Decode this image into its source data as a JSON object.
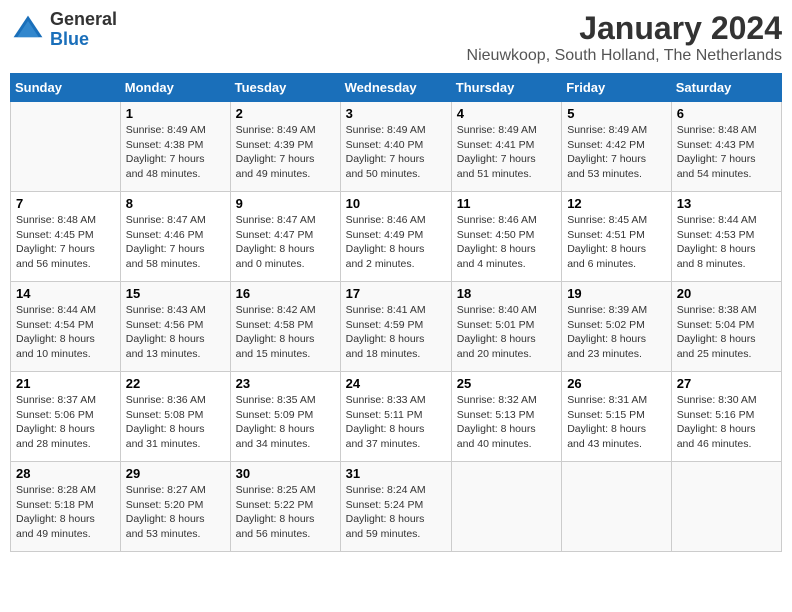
{
  "header": {
    "logo_line1": "General",
    "logo_line2": "Blue",
    "title": "January 2024",
    "subtitle": "Nieuwkoop, South Holland, The Netherlands"
  },
  "calendar": {
    "days_of_week": [
      "Sunday",
      "Monday",
      "Tuesday",
      "Wednesday",
      "Thursday",
      "Friday",
      "Saturday"
    ],
    "weeks": [
      [
        {
          "day": "",
          "info": ""
        },
        {
          "day": "1",
          "info": "Sunrise: 8:49 AM\nSunset: 4:38 PM\nDaylight: 7 hours\nand 48 minutes."
        },
        {
          "day": "2",
          "info": "Sunrise: 8:49 AM\nSunset: 4:39 PM\nDaylight: 7 hours\nand 49 minutes."
        },
        {
          "day": "3",
          "info": "Sunrise: 8:49 AM\nSunset: 4:40 PM\nDaylight: 7 hours\nand 50 minutes."
        },
        {
          "day": "4",
          "info": "Sunrise: 8:49 AM\nSunset: 4:41 PM\nDaylight: 7 hours\nand 51 minutes."
        },
        {
          "day": "5",
          "info": "Sunrise: 8:49 AM\nSunset: 4:42 PM\nDaylight: 7 hours\nand 53 minutes."
        },
        {
          "day": "6",
          "info": "Sunrise: 8:48 AM\nSunset: 4:43 PM\nDaylight: 7 hours\nand 54 minutes."
        }
      ],
      [
        {
          "day": "7",
          "info": "Sunrise: 8:48 AM\nSunset: 4:45 PM\nDaylight: 7 hours\nand 56 minutes."
        },
        {
          "day": "8",
          "info": "Sunrise: 8:47 AM\nSunset: 4:46 PM\nDaylight: 7 hours\nand 58 minutes."
        },
        {
          "day": "9",
          "info": "Sunrise: 8:47 AM\nSunset: 4:47 PM\nDaylight: 8 hours\nand 0 minutes."
        },
        {
          "day": "10",
          "info": "Sunrise: 8:46 AM\nSunset: 4:49 PM\nDaylight: 8 hours\nand 2 minutes."
        },
        {
          "day": "11",
          "info": "Sunrise: 8:46 AM\nSunset: 4:50 PM\nDaylight: 8 hours\nand 4 minutes."
        },
        {
          "day": "12",
          "info": "Sunrise: 8:45 AM\nSunset: 4:51 PM\nDaylight: 8 hours\nand 6 minutes."
        },
        {
          "day": "13",
          "info": "Sunrise: 8:44 AM\nSunset: 4:53 PM\nDaylight: 8 hours\nand 8 minutes."
        }
      ],
      [
        {
          "day": "14",
          "info": "Sunrise: 8:44 AM\nSunset: 4:54 PM\nDaylight: 8 hours\nand 10 minutes."
        },
        {
          "day": "15",
          "info": "Sunrise: 8:43 AM\nSunset: 4:56 PM\nDaylight: 8 hours\nand 13 minutes."
        },
        {
          "day": "16",
          "info": "Sunrise: 8:42 AM\nSunset: 4:58 PM\nDaylight: 8 hours\nand 15 minutes."
        },
        {
          "day": "17",
          "info": "Sunrise: 8:41 AM\nSunset: 4:59 PM\nDaylight: 8 hours\nand 18 minutes."
        },
        {
          "day": "18",
          "info": "Sunrise: 8:40 AM\nSunset: 5:01 PM\nDaylight: 8 hours\nand 20 minutes."
        },
        {
          "day": "19",
          "info": "Sunrise: 8:39 AM\nSunset: 5:02 PM\nDaylight: 8 hours\nand 23 minutes."
        },
        {
          "day": "20",
          "info": "Sunrise: 8:38 AM\nSunset: 5:04 PM\nDaylight: 8 hours\nand 25 minutes."
        }
      ],
      [
        {
          "day": "21",
          "info": "Sunrise: 8:37 AM\nSunset: 5:06 PM\nDaylight: 8 hours\nand 28 minutes."
        },
        {
          "day": "22",
          "info": "Sunrise: 8:36 AM\nSunset: 5:08 PM\nDaylight: 8 hours\nand 31 minutes."
        },
        {
          "day": "23",
          "info": "Sunrise: 8:35 AM\nSunset: 5:09 PM\nDaylight: 8 hours\nand 34 minutes."
        },
        {
          "day": "24",
          "info": "Sunrise: 8:33 AM\nSunset: 5:11 PM\nDaylight: 8 hours\nand 37 minutes."
        },
        {
          "day": "25",
          "info": "Sunrise: 8:32 AM\nSunset: 5:13 PM\nDaylight: 8 hours\nand 40 minutes."
        },
        {
          "day": "26",
          "info": "Sunrise: 8:31 AM\nSunset: 5:15 PM\nDaylight: 8 hours\nand 43 minutes."
        },
        {
          "day": "27",
          "info": "Sunrise: 8:30 AM\nSunset: 5:16 PM\nDaylight: 8 hours\nand 46 minutes."
        }
      ],
      [
        {
          "day": "28",
          "info": "Sunrise: 8:28 AM\nSunset: 5:18 PM\nDaylight: 8 hours\nand 49 minutes."
        },
        {
          "day": "29",
          "info": "Sunrise: 8:27 AM\nSunset: 5:20 PM\nDaylight: 8 hours\nand 53 minutes."
        },
        {
          "day": "30",
          "info": "Sunrise: 8:25 AM\nSunset: 5:22 PM\nDaylight: 8 hours\nand 56 minutes."
        },
        {
          "day": "31",
          "info": "Sunrise: 8:24 AM\nSunset: 5:24 PM\nDaylight: 8 hours\nand 59 minutes."
        },
        {
          "day": "",
          "info": ""
        },
        {
          "day": "",
          "info": ""
        },
        {
          "day": "",
          "info": ""
        }
      ]
    ]
  }
}
